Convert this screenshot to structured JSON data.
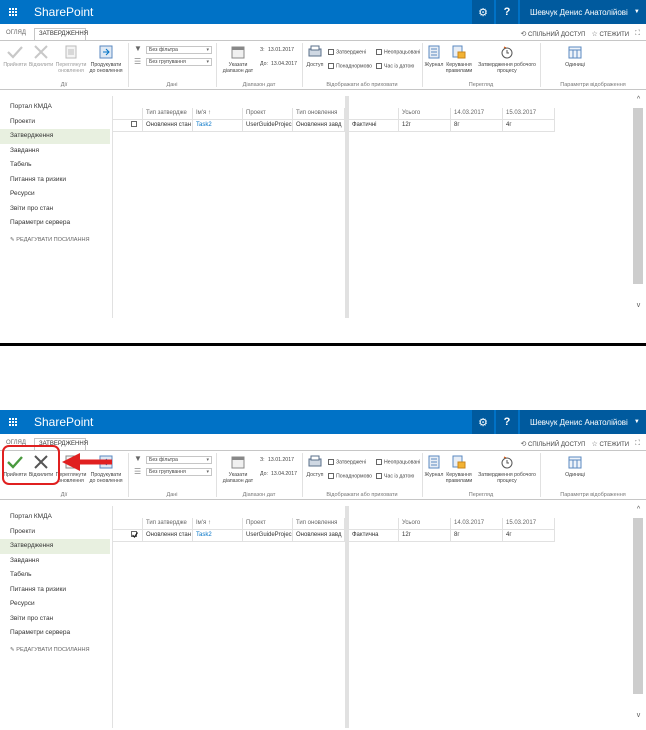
{
  "suitebar": {
    "brand": "SharePoint",
    "user": "Шевчук Денис Анатолійові"
  },
  "tabs": {
    "overview": "ОГЛЯД",
    "approvals": "ЗАТВЕРДЖЕННЯ"
  },
  "top_actions": {
    "share": "СПІЛЬНИЙ ДОСТУП",
    "follow": "СТЕЖИТИ"
  },
  "ribbon": {
    "accept": "Прийняти",
    "reject": "Відхилити",
    "preview": "Переглянути оновлення",
    "history": "Продукувати до оновлення",
    "group_actions": "Дії",
    "filter": "Без фільтра",
    "grouping": "Без групування",
    "group_data": "Дані",
    "date_from_lbl": "З:",
    "date_from": "13.01.2017",
    "date_to_lbl": "До:",
    "date_to": "13.04.2017",
    "set_range": "Указати діапазон дат",
    "group_range": "Діапазон дат",
    "access": "Доступ",
    "cb_approved": "Затверджені",
    "cb_unapproved": "Неопрацьовані",
    "cb_overtime": "Понаднормово",
    "cb_time_with_date": "Час із датою",
    "group_show": "Відображати або приховати",
    "history_log": "Журнал",
    "rules": "Керування правилами",
    "approve_week": "Затвердження робочого процесу",
    "group_history": "Перегляд",
    "units": "Одиниці",
    "group_display": "Параметри відображення"
  },
  "nav": {
    "items": [
      "Портал КМДА",
      "Проекти",
      "Затвердження",
      "Завдання",
      "Табель",
      "Питання та ризики",
      "Ресурси",
      "Звіти про стан",
      "Параметри сервера"
    ],
    "edit": "РЕДАГУВАТИ ПОСИЛАННЯ"
  },
  "grid": {
    "headers_left": [
      "Тип затвердже",
      "Ім'я ↑",
      "Проект",
      "Тип оновлення"
    ],
    "headers_right": [
      "",
      "Усього",
      "14.03.2017",
      "15.03.2017"
    ],
    "row_left": [
      "Оновлення стан",
      "Task2",
      "UserGuideProjec",
      "Оновлення завд"
    ],
    "row_right_top": [
      "Фактичні",
      "12г",
      "8г",
      "4г"
    ],
    "row_right_bottom": [
      "Фактична",
      "12г",
      "8г",
      "4г"
    ]
  }
}
